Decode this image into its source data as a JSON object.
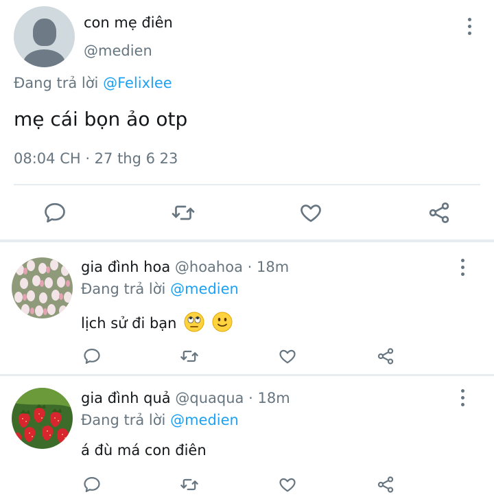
{
  "main_tweet": {
    "author_name": "con mẹ điên",
    "author_handle": "@medien",
    "reply_prefix": "Đang trả lời",
    "reply_to": "@Felixlee",
    "text": "mẹ cái bọn ảo otp",
    "timestamp": "08:04 CH · 27 thg 6 23",
    "icons": [
      "more-vertical-icon",
      "reply-icon",
      "retweet-icon",
      "like-icon",
      "share-icon"
    ]
  },
  "replies": [
    {
      "author_name": "gia đình hoa",
      "author_handle": "@hoahoa",
      "separator": "·",
      "time": "18m",
      "reply_prefix": "Đang trả lời",
      "reply_to": "@medien",
      "text": "lịch sử đi bạn",
      "emojis": [
        "rolling-eyes-emoji",
        "slight-smile-emoji"
      ],
      "avatar": "tulip-field-avatar"
    },
    {
      "author_name": "gia đình quả",
      "author_handle": "@quaqua",
      "separator": "·",
      "time": "18m",
      "reply_prefix": "Đang trả lời",
      "reply_to": "@medien",
      "text": "á đù má con điên",
      "avatar": "strawberries-avatar"
    }
  ],
  "colors": {
    "accent": "#1da1f2",
    "muted": "#66757f",
    "divider": "#e6ecf0",
    "text": "#14171a"
  }
}
